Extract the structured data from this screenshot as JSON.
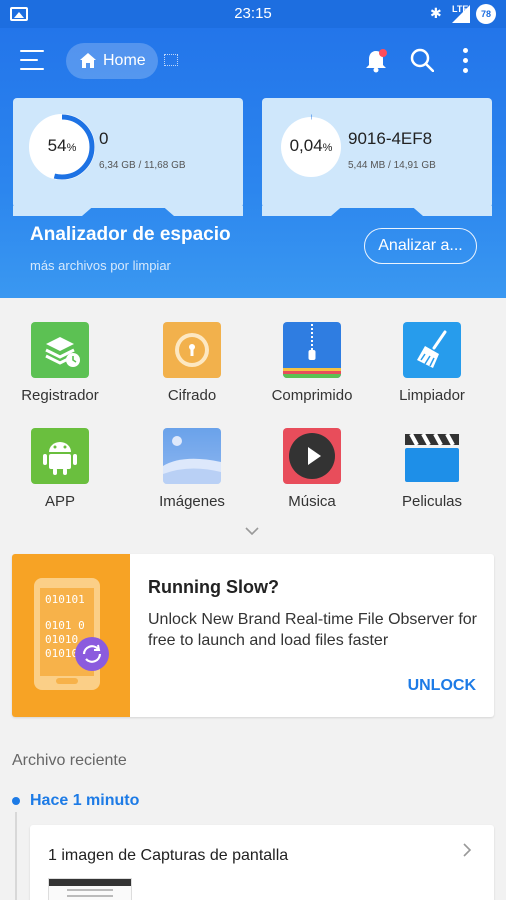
{
  "status_bar": {
    "time": "23:15",
    "network": "LTE",
    "battery": "78"
  },
  "toolbar": {
    "home_label": "Home"
  },
  "storage": [
    {
      "percent_value": "54",
      "percent_sign": "%",
      "name": "0",
      "usage": "6,34 GB / 11,68 GB",
      "fraction": 0.54
    },
    {
      "percent_value": "0,04",
      "percent_sign": "%",
      "name": "9016-4EF8",
      "usage": "5,44 MB / 14,91 GB",
      "fraction": 0.0004
    }
  ],
  "analyzer": {
    "title": "Analizador de espacio",
    "subtitle": "más archivos por limpiar",
    "button": "Analizar a..."
  },
  "categories": [
    {
      "label": "Registrador",
      "icon": "recorder-stack-icon",
      "color": "#5cc153"
    },
    {
      "label": "Cifrado",
      "icon": "lock-icon",
      "color": "#f2b14c"
    },
    {
      "label": "Comprimido",
      "icon": "zip-icon",
      "color": "#2f7de1"
    },
    {
      "label": "Limpiador",
      "icon": "broom-icon",
      "color": "#279cec"
    },
    {
      "label": "APP",
      "icon": "android-icon",
      "color": "#6abf3e"
    },
    {
      "label": "Imágenes",
      "icon": "image-icon",
      "color": "#6aa2ea"
    },
    {
      "label": "Música",
      "icon": "play-icon",
      "color": "#e84d5b"
    },
    {
      "label": "Peliculas",
      "icon": "clapperboard-icon",
      "color": "#1e8fe8"
    }
  ],
  "promo": {
    "title": "Running Slow?",
    "body": "Unlock New Brand Real-time File Observer for free to launch and load files faster",
    "action": "UNLOCK",
    "art_binary": [
      "010101",
      "0101 0",
      "01010",
      "01010"
    ]
  },
  "recent": {
    "heading": "Archivo reciente",
    "time_label": "Hace 1 minuto",
    "item_title": "1 imagen de Capturas de pantalla"
  }
}
